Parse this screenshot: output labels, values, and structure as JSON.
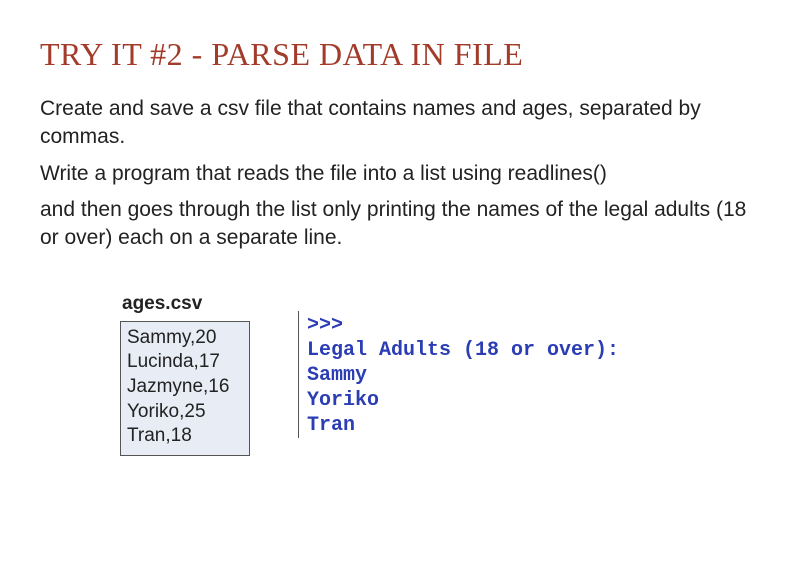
{
  "heading": "TRY IT #2 - PARSE DATA IN FILE",
  "paragraphs": [
    "Create and save a csv file that contains names and ages, separated by commas.",
    "Write a program that reads the file into a list using readlines()",
    "and then goes through the list only printing the names of the legal adults (18 or over) each on a separate line."
  ],
  "csv": {
    "filename": "ages.csv",
    "rows": [
      "Sammy,20",
      "Lucinda,17",
      "Jazmyne,16",
      "Yoriko,25",
      "Tran,18"
    ]
  },
  "output": {
    "lines": [
      ">>> ",
      "Legal Adults (18 or over):",
      "Sammy",
      "Yoriko",
      "Tran"
    ]
  }
}
